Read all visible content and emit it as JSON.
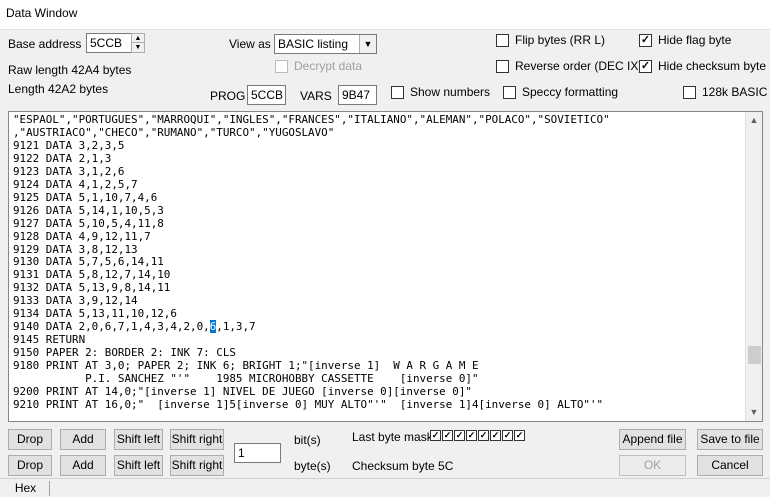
{
  "window": {
    "title": "Data Window"
  },
  "header": {
    "base_address_label": "Base address",
    "base_address_value": "5CCB",
    "raw_length": "Raw length 42A4 bytes",
    "length": "Length 42A2 bytes",
    "view_as_label": "View as",
    "view_as_value": "BASIC listing",
    "decrypt_data": "Decrypt data",
    "prog_label": "PROG",
    "prog_value": "5CCB",
    "vars_label": "VARS",
    "vars_value": "9B47",
    "show_numbers": "Show numbers",
    "speccy_formatting": "Speccy formatting",
    "flip_bytes": "Flip bytes (RR L)",
    "reverse_order": "Reverse order (DEC IX)",
    "hide_flag_byte": "Hide flag byte",
    "hide_checksum_byte": "Hide checksum byte",
    "basic_128k": "128k BASIC"
  },
  "checkbox_states": {
    "flip_bytes": false,
    "reverse_order": false,
    "hide_flag_byte": true,
    "hide_checksum_byte": true,
    "decrypt_data": false,
    "show_numbers": false,
    "speccy_formatting": false,
    "basic_128k": false
  },
  "listing": {
    "lines_before": [
      "\"ESPAOL\",\"PORTUGUES\",\"MARROQUI\",\"INGLES\",\"FRANCES\",\"ITALIANO\",\"ALEMAN\",\"POLACO\",\"SOVIETICO\"",
      ",\"AUSTRIACO\",\"CHECO\",\"RUMANO\",\"TURCO\",\"YUGOSLAVO\"",
      "9121 DATA 3,2,3,5",
      "9122 DATA 2,1,3",
      "9123 DATA 3,1,2,6",
      "9124 DATA 4,1,2,5,7",
      "9125 DATA 5,1,10,7,4,6",
      "9126 DATA 5,14,1,10,5,3",
      "9127 DATA 5,10,5,4,11,8",
      "9128 DATA 4,9,12,11,7",
      "9129 DATA 3,8,12,13",
      "9130 DATA 5,7,5,6,14,11",
      "9131 DATA 5,8,12,7,14,10",
      "9132 DATA 5,13,9,8,14,11",
      "9133 DATA 3,9,12,14",
      "9134 DATA 5,13,11,10,12,6"
    ],
    "selected_line_prefix": "9140 DATA 2,0,6,7,1,4,3,4,2,0,",
    "selected_text": "6",
    "selected_line_suffix": ",1,3,7",
    "lines_after": [
      "9145 RETURN",
      "9150 PAPER 2: BORDER 2: INK 7: CLS",
      "9180 PRINT AT 3,0; PAPER 2; INK 6; BRIGHT 1;\"[inverse 1]  W A R G A M E",
      "           P.I. SANCHEZ \"'\"    1985 MICROHOBBY CASSETTE    [inverse 0]\"",
      "9200 PRINT AT 14,0;\"[inverse 1] NIVEL DE JUEGO [inverse 0][inverse 0]\"",
      "9210 PRINT AT 16,0;\"  [inverse 1]5[inverse 0] MUY ALTO\"'\"  [inverse 1]4[inverse 0] ALTO\"'\""
    ]
  },
  "bottom": {
    "drop": "Drop",
    "add": "Add",
    "shift_left": "Shift left",
    "shift_right": "Shift right",
    "shift_value": "1",
    "bits_label": "bit(s)",
    "bytes_label": "byte(s)",
    "last_byte_mask_label": "Last byte mask",
    "last_byte_mask": [
      true,
      true,
      true,
      true,
      true,
      true,
      true,
      true
    ],
    "checksum": "Checksum byte 5C",
    "append_file": "Append file",
    "save_to_file": "Save to file",
    "ok": "OK",
    "cancel": "Cancel"
  },
  "status": {
    "hex": "Hex"
  },
  "colors": {
    "selection": "#0078d7",
    "window_bg": "#f0f0f0",
    "button_bg": "#e1e1e1"
  }
}
